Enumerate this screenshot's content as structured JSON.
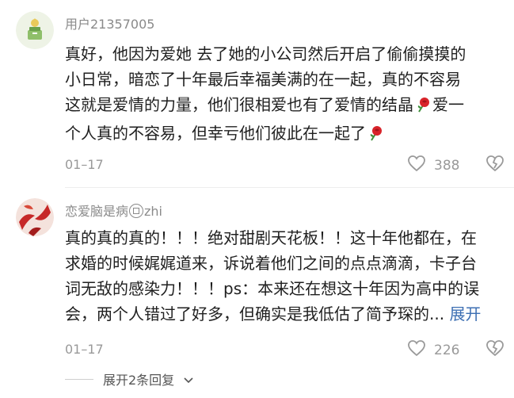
{
  "comments": [
    {
      "username": "用户21357005",
      "lines": [
        "真好，他因为爱她 去了她的小公司然后开启了偷偷摸摸的",
        "小日常，暗恋了十年最后幸福美满的在一起，真的不容易",
        "这就是爱情的力量，他们很相爱也有了爱情的结晶",
        "爱一",
        "个人真的不容易，但幸亏他们彼此在一起了"
      ],
      "date": "01–17",
      "likes": "388",
      "icons": {
        "like": "heart-outline-icon",
        "dislike": "broken-heart-icon",
        "emoji": "rose-emoji-icon"
      }
    },
    {
      "username": "恋爱脑是病",
      "username_suffix": "zhi",
      "lines": [
        "真的真的真的！！！绝对甜剧天花板！！这十年他都在，在",
        "求婚的时候娓娓道来，诉说着他们之间的点点滴滴，卡子台",
        "词无敌的感染力！！！ps：本来还在想这十年因为高中的误",
        "会，两个人错过了好多，但确实是我低估了简予琛的..."
      ],
      "expand": "展开",
      "date": "01–17",
      "likes": "226",
      "replies": "展开2条回复",
      "icons": {
        "like": "heart-outline-icon",
        "dislike": "broken-heart-icon"
      }
    }
  ],
  "colors": {
    "text": "#1f1f1f",
    "meta": "#999999",
    "link": "#3d6fb3",
    "rose": "#d8232a"
  }
}
